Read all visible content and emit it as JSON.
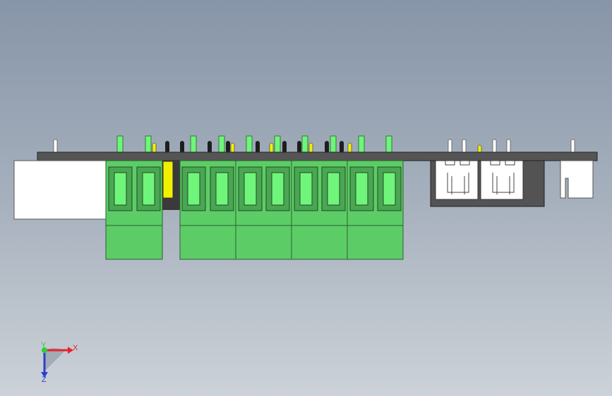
{
  "viewport": {
    "background_top": "#8795a8",
    "background_bottom": "#ccd2d8"
  },
  "model": {
    "pcb_color": "#555555",
    "terminal_color": "#5ccd66",
    "terminal_window_color": "#70f57b",
    "yellow_part_color": "#f2f000",
    "white_connector_color": "#ffffff",
    "housing_dark_color": "#535353",
    "terminal_block_count": 5
  },
  "triad": {
    "x_label": "X",
    "y_label": "Y",
    "z_label": "Z",
    "x_color": "#e8232c",
    "y_color": "#2fcf3a",
    "z_color": "#2a3fd0"
  }
}
